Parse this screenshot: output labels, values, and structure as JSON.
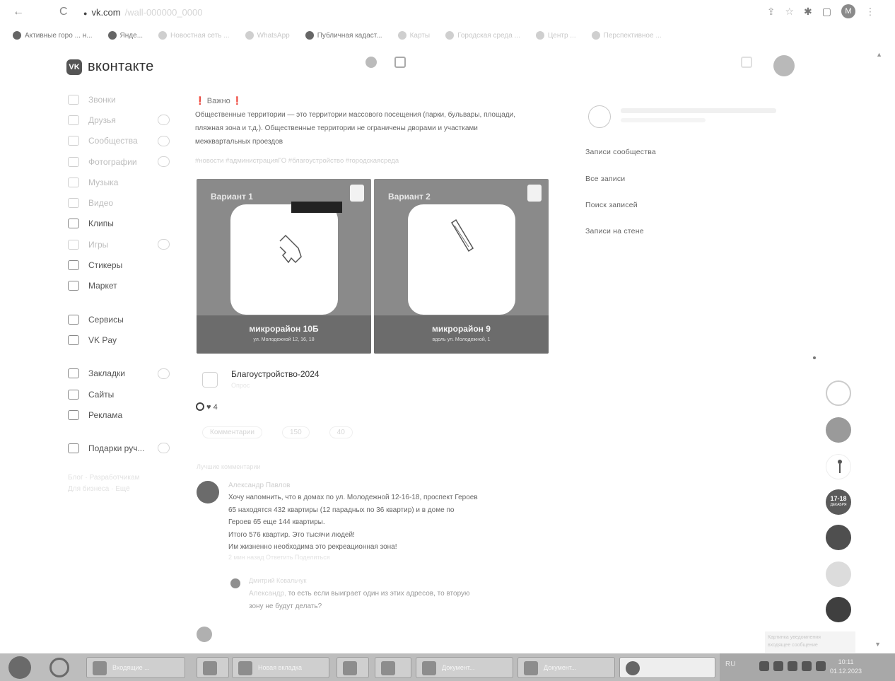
{
  "browser": {
    "back": "←",
    "reload": "C",
    "url": "vk.com",
    "url_rest": "/wall-000000_0000",
    "bookmarks": [
      {
        "label": "Активные горо ... н...",
        "light": false
      },
      {
        "label": "Янде...",
        "light": false
      },
      {
        "label": "Новостная сеть ...",
        "light": true
      },
      {
        "label": "WhatsApp",
        "light": true
      },
      {
        "label": "Публичная кадаст...",
        "light": false
      },
      {
        "label": "Карты",
        "light": true
      },
      {
        "label": "Городская среда ...",
        "light": true
      },
      {
        "label": "Центр ...",
        "light": true
      },
      {
        "label": "Перспективное ...",
        "light": true
      }
    ],
    "profile_letter": "М"
  },
  "vk": {
    "logo_letters": "VK",
    "title": "вконтакте"
  },
  "sidebar": {
    "items": [
      {
        "label": "Звонки",
        "dark": false,
        "badge": false
      },
      {
        "label": "Друзья",
        "dark": false,
        "badge": true
      },
      {
        "label": "Сообщества",
        "dark": false,
        "badge": true
      },
      {
        "label": "Фотографии",
        "dark": false,
        "badge": true
      },
      {
        "label": "Музыка",
        "dark": false,
        "badge": false
      },
      {
        "label": "Видео",
        "dark": false,
        "badge": false
      },
      {
        "label": "Клипы",
        "dark": true,
        "badge": false
      },
      {
        "label": "Игры",
        "dark": false,
        "badge": true
      },
      {
        "label": "Стикеры",
        "dark": true,
        "badge": false
      },
      {
        "label": "Маркет",
        "dark": true,
        "badge": false
      }
    ],
    "items2": [
      {
        "label": "Сервисы",
        "dark": true,
        "badge": false
      },
      {
        "label": "VK Pay",
        "dark": true,
        "badge": false
      }
    ],
    "items3": [
      {
        "label": "Закладки",
        "dark": true,
        "badge": true
      },
      {
        "label": "Сайты",
        "dark": true,
        "badge": false
      },
      {
        "label": "Реклама",
        "dark": true,
        "badge": false
      }
    ],
    "items4": [
      {
        "label": "Подарки руч...",
        "dark": true,
        "badge": true
      }
    ]
  },
  "post": {
    "important": "❗ Важно ❗",
    "text_dark": "Общественные территории — это территории массового посещения (парки, бульвары, площади, пляжная зона и т.д.). Общественные территории не ограничены дворами и участками межквартальных проездов",
    "tags": "#новости #администрацияГО #благоустройство #городскаясреда",
    "photos": [
      {
        "title": "Вариант 1",
        "district": "микрорайон 10Б",
        "address": "ул. Молодежной 12, 16, 18"
      },
      {
        "title": "Вариант 2",
        "district": "микрорайон 9",
        "address": "вдоль ул. Молодежной, 1"
      }
    ],
    "attachment": {
      "title": "Благоустройство-2024",
      "sub": "Опрос"
    },
    "reactions": "4",
    "actions": [
      "Комментарии",
      "150",
      "40"
    ],
    "comments_header": "Лучшие комментарии"
  },
  "comment": {
    "author": "Александр Павлов",
    "lines": [
      "Хочу напомнить, что в домах по ул. Молодежной 12-16-18, проспект Героев",
      "65 находятся 432 квартиры (12 парадных по 36 квартир) и в доме по",
      "Героев 65 еще 144 квартиры.",
      "Итого 576 квартир. Это тысячи людей!",
      "Им жизненно необходима это рекреационная зона!"
    ],
    "meta": "2 мин назад   Ответить   Поделиться"
  },
  "reply": {
    "author": "Дмитрий Ковальчук",
    "prefix": "Александр,",
    "line1": " то есть если выиграет один из этих адресов, то вторую",
    "line2": "зону не будут делать?"
  },
  "right_col": {
    "items": [
      "Записи сообщества",
      "Все записи",
      "Поиск записей",
      "Записи на стене"
    ]
  },
  "notifications": {
    "event_badge_top": "17-18",
    "event_badge_bottom": "ДЕКАБРЯ"
  },
  "toast": {
    "line1": "Картинка уведомления",
    "line2": "входящее сообщение"
  },
  "taskbar": {
    "lang": "RU",
    "clock_time": "10:11",
    "clock_date": "01.12.2023",
    "buttons": [
      "Входящие ...",
      "",
      "Новая вкладка",
      "",
      "",
      "Документ...",
      "Документ...",
      ""
    ]
  },
  "colors": {
    "accent_gray": "#8a8a8a",
    "taskbar": "#bdbdbd"
  }
}
